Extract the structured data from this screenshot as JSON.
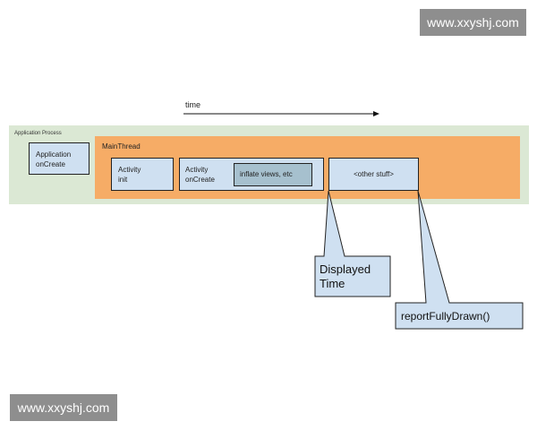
{
  "watermarks": {
    "top": "www.xxyshj.com",
    "bottom": "www.xxyshj.com"
  },
  "timeline": {
    "label": "time"
  },
  "application_process": {
    "label": "Application Process",
    "app_oncreate": {
      "line1": "Application",
      "line2": "onCreate"
    }
  },
  "main_thread": {
    "label": "MainThread",
    "activity_init": {
      "line1": "Activity",
      "line2": "init"
    },
    "activity_oncreate": {
      "line1": "Activity",
      "line2": "onCreate"
    },
    "inflate_views": "inflate views, etc",
    "other_stuff": "<other stuff>"
  },
  "callouts": {
    "displayed_time": {
      "line1": "Displayed",
      "line2": "Time"
    },
    "report_fully_drawn": "reportFullyDrawn()"
  },
  "colors": {
    "application_process_bg": "#dbe8d4",
    "main_thread_bg": "#f6ac66",
    "box_bg": "#cfe0f1",
    "inflate_bg": "#a6c0ce",
    "watermark_bg": "#8e8e8e"
  }
}
